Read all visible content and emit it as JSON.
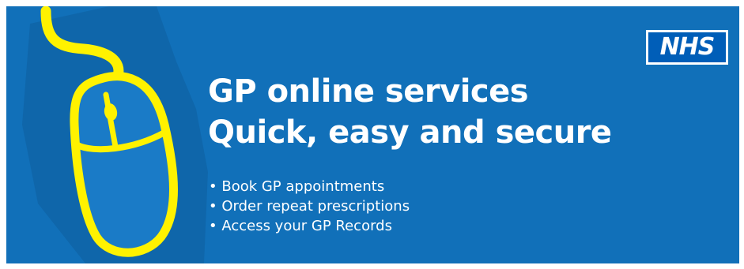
{
  "colors": {
    "background": "#1170b9",
    "accent": "#fff200",
    "text": "#ffffff",
    "logo_blue": "#005eb8"
  },
  "logo": {
    "text": "NHS"
  },
  "headline": {
    "line1": "GP online services",
    "line2": "Quick, easy and secure"
  },
  "bullets": [
    "Book GP appointments",
    "Order repeat prescriptions",
    "Access your GP Records"
  ],
  "icons": {
    "mouse": "computer-mouse-icon"
  }
}
